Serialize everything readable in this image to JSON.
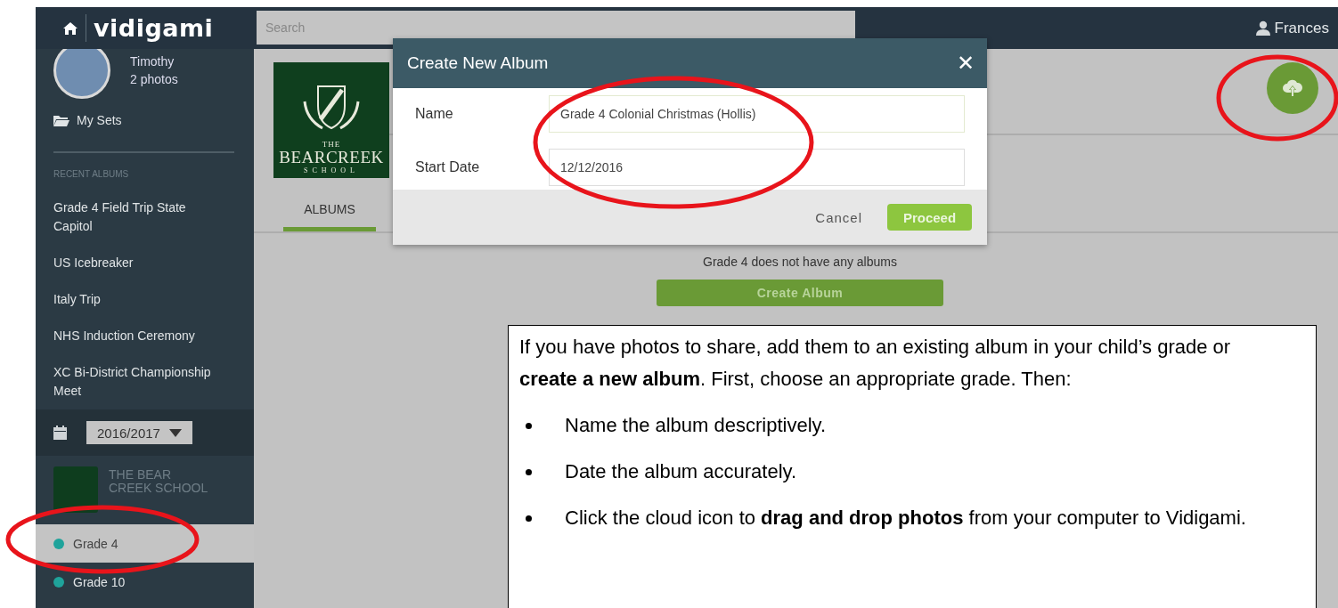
{
  "topbar": {
    "brand": "vidigami",
    "search": {
      "placeholder": "Search"
    },
    "user": "Frances"
  },
  "sidebar": {
    "profile": {
      "name": "Timothy",
      "count": "2 photos"
    },
    "my_sets": "My Sets",
    "recent_heading": "RECENT ALBUMS",
    "recent_albums": [
      "Grade 4 Field Trip State Capitol",
      "US Icebreaker",
      "Italy Trip",
      "NHS Induction Ceremony",
      "XC Bi-District Championship Meet"
    ],
    "year": "2016/2017",
    "school": "THE BEAR CREEK SCHOOL",
    "grades": [
      {
        "label": "Grade 4",
        "selected": true,
        "color": "#1fa39b"
      },
      {
        "label": "Grade 10",
        "selected": false,
        "color": "#1fa39b"
      }
    ]
  },
  "main": {
    "logo": {
      "top": "THE",
      "name": "BEARCREEK",
      "bottom": "SCHOOL"
    },
    "tabs": [
      {
        "label": "ALBUMS",
        "selected": true
      }
    ],
    "empty_message": "Grade 4 does not have any albums",
    "create_button": "Create Album"
  },
  "modal": {
    "title": "Create New Album",
    "close": "✕",
    "fields": [
      {
        "label": "Name",
        "value": "Grade 4 Colonial Christmas (Hollis)"
      },
      {
        "label": "Start Date",
        "value": "12/12/2016"
      }
    ],
    "cancel": "Cancel",
    "proceed": "Proceed"
  },
  "callout": {
    "intro": "If you have photos to share, add them to an existing album in your child’s grade or **create a new album**. First, choose an appropriate grade. Then:",
    "bullets": [
      "Name the album descriptively.",
      "Date the album accurately.",
      "Click the cloud icon to **drag and drop photos** from your computer to Vidigami."
    ]
  }
}
